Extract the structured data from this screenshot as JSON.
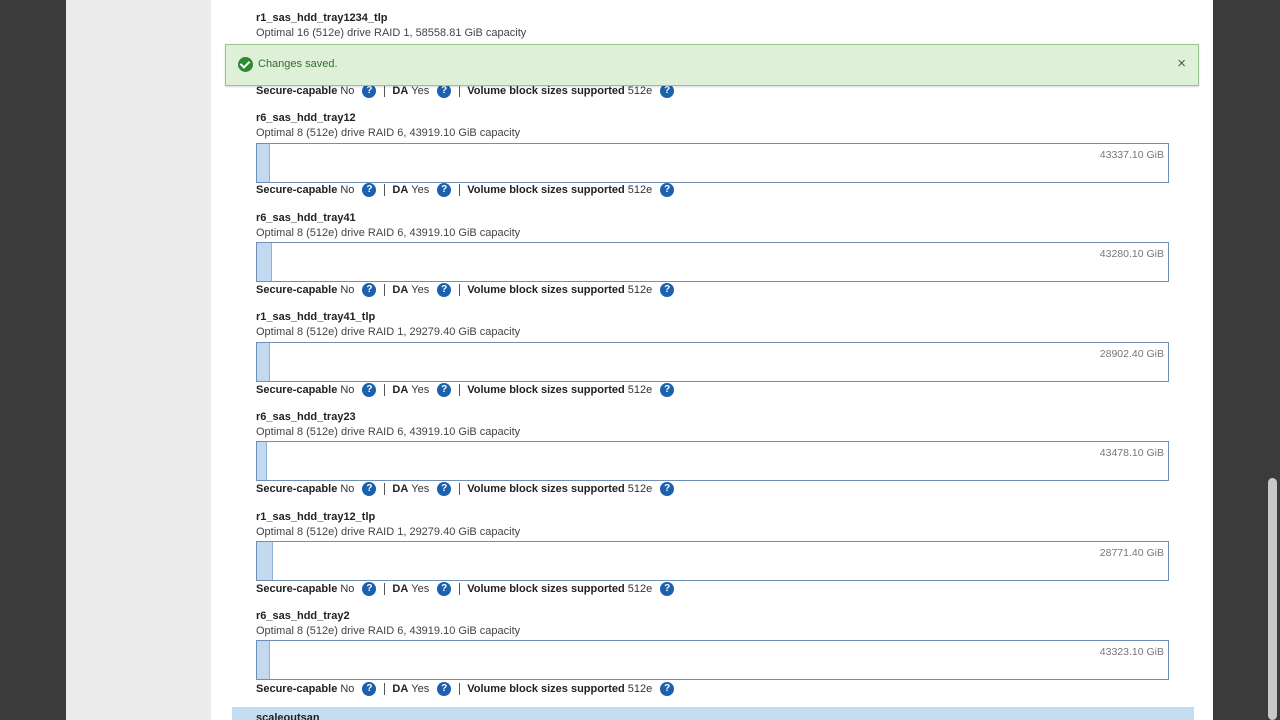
{
  "toast": {
    "message": "Changes saved.",
    "close_label": "×"
  },
  "labels": {
    "secure": "Secure-capable",
    "da": "DA",
    "vbs": "Volume block sizes supported",
    "help": "?"
  },
  "pools": [
    {
      "name": "r1_sas_hdd_tray1234_tlp",
      "description": "Optimal 16 (512e) drive RAID 1, 58558.81 GiB capacity",
      "free": "",
      "used_fraction": 0.015,
      "secure": "No",
      "da": "Yes",
      "block_sizes": "512e"
    },
    {
      "name": "r6_sas_hdd_tray12",
      "description": "Optimal 8 (512e) drive RAID 6, 43919.10 GiB capacity",
      "free": "43337.10 GiB",
      "used_fraction": 0.013,
      "secure": "No",
      "da": "Yes",
      "block_sizes": "512e"
    },
    {
      "name": "r6_sas_hdd_tray41",
      "description": "Optimal 8 (512e) drive RAID 6, 43919.10 GiB capacity",
      "free": "43280.10 GiB",
      "used_fraction": 0.015,
      "secure": "No",
      "da": "Yes",
      "block_sizes": "512e"
    },
    {
      "name": "r1_sas_hdd_tray41_tlp",
      "description": "Optimal 8 (512e) drive RAID 1, 29279.40 GiB capacity",
      "free": "28902.40 GiB",
      "used_fraction": 0.013,
      "secure": "No",
      "da": "Yes",
      "block_sizes": "512e"
    },
    {
      "name": "r6_sas_hdd_tray23",
      "description": "Optimal 8 (512e) drive RAID 6, 43919.10 GiB capacity",
      "free": "43478.10 GiB",
      "used_fraction": 0.01,
      "secure": "No",
      "da": "Yes",
      "block_sizes": "512e"
    },
    {
      "name": "r1_sas_hdd_tray12_tlp",
      "description": "Optimal 8 (512e) drive RAID 1, 29279.40 GiB capacity",
      "free": "28771.40 GiB",
      "used_fraction": 0.017,
      "secure": "No",
      "da": "Yes",
      "block_sizes": "512e"
    },
    {
      "name": "r6_sas_hdd_tray2",
      "description": "Optimal 8 (512e) drive RAID 6, 43919.10 GiB capacity",
      "free": "43323.10 GiB",
      "used_fraction": 0.013,
      "secure": "No",
      "da": "Yes",
      "block_sizes": "512e"
    }
  ],
  "next_pool": {
    "name": "scaleoutsan"
  }
}
